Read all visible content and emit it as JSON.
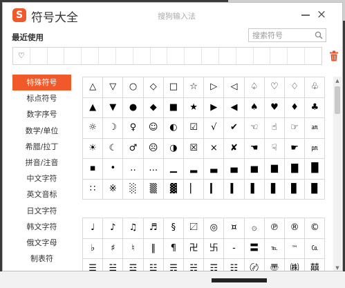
{
  "window": {
    "logo_letter": "S",
    "title": "符号大全",
    "subtitle": "搜狗输入法",
    "close_glyph": "×"
  },
  "recent": {
    "label": "最近使用",
    "items": [
      "♡",
      "",
      "",
      "",
      "",
      "",
      "",
      "",
      "",
      "",
      "",
      "",
      "",
      "",
      "",
      "",
      "",
      ""
    ]
  },
  "search": {
    "placeholder": "搜索符号"
  },
  "categories": [
    {
      "label": "特殊符号",
      "active": true
    },
    {
      "label": "标点符号",
      "active": false
    },
    {
      "label": "数字序号",
      "active": false
    },
    {
      "label": "数学/单位",
      "active": false
    },
    {
      "label": "希腊/拉丁",
      "active": false
    },
    {
      "label": "拼音/注音",
      "active": false
    },
    {
      "label": "中文字符",
      "active": false
    },
    {
      "label": "英文音标",
      "active": false
    },
    {
      "label": "日文字符",
      "active": false
    },
    {
      "label": "韩文字符",
      "active": false
    },
    {
      "label": "俄文字母",
      "active": false
    },
    {
      "label": "制表符",
      "active": false
    }
  ],
  "symbol_groups": [
    [
      [
        "△",
        "▽",
        "○",
        "◇",
        "□",
        "☆",
        "▷",
        "◁",
        "♤",
        "♡",
        "♢",
        "♧"
      ],
      [
        "▲",
        "▼",
        "●",
        "◆",
        "■",
        "★",
        "▶",
        "◀",
        "♠",
        "♥",
        "♦",
        "♣"
      ],
      [
        "☼",
        "☽",
        "♀",
        "☺",
        "◐",
        "☑",
        "√",
        "✔",
        "☜",
        "☝",
        "☞",
        "㏂"
      ],
      [
        "☀",
        "☾",
        "♂",
        "☹",
        "◑",
        "☒",
        "×",
        "✘",
        "☚",
        "☟",
        "☛",
        "㏘"
      ],
      [
        "▪",
        "•",
        "‥",
        "…",
        "▁",
        "▂",
        "▃",
        "▄",
        "▅",
        "▆",
        "▇",
        "█"
      ],
      [
        "∷",
        "※",
        "░",
        "▒",
        "▓",
        "▏",
        "▎",
        "▍",
        "▌",
        "▋",
        "▊",
        "▉"
      ]
    ],
    [
      [
        "♩",
        "♪",
        "♫",
        "♬",
        "§",
        "〼",
        "◎",
        "¤",
        "۞",
        "℗",
        "®",
        "©"
      ],
      [
        "♭",
        "♯",
        "♮",
        "‖",
        "¶",
        "卍",
        "卐",
        "‐",
        "〓",
        "℡",
        "™",
        "㏇"
      ],
      [
        "☰",
        "☱",
        "☲",
        "☳",
        "☴",
        "☵",
        "☶",
        "☷",
        "〄",
        "〠",
        "㈱",
        "囍"
      ]
    ]
  ],
  "colors": {
    "accent": "#f0592a",
    "grid_line": "#d8d8d8"
  }
}
